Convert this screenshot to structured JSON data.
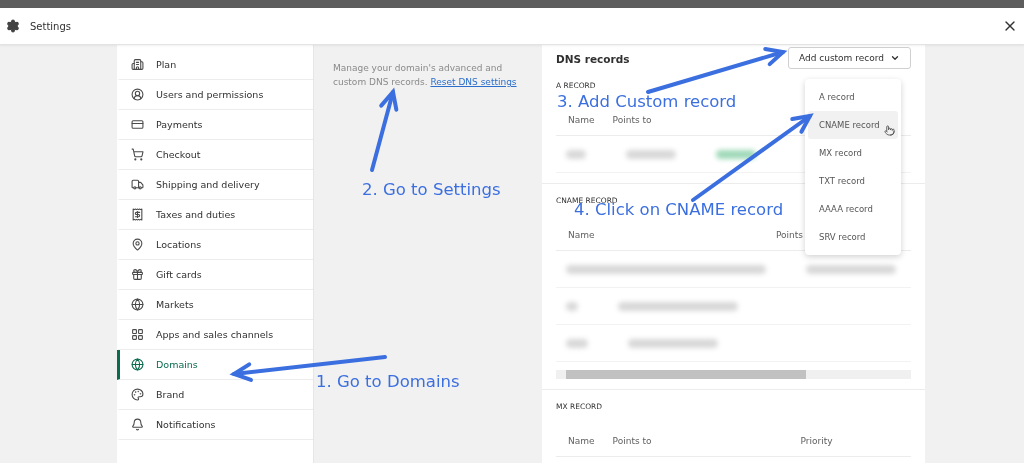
{
  "window": {
    "title": "Settings"
  },
  "sidebar": {
    "items": [
      {
        "label": "Plan",
        "selected": false
      },
      {
        "label": "Users and permissions",
        "selected": false
      },
      {
        "label": "Payments",
        "selected": false
      },
      {
        "label": "Checkout",
        "selected": false
      },
      {
        "label": "Shipping and delivery",
        "selected": false
      },
      {
        "label": "Taxes and duties",
        "selected": false
      },
      {
        "label": "Locations",
        "selected": false
      },
      {
        "label": "Gift cards",
        "selected": false
      },
      {
        "label": "Markets",
        "selected": false
      },
      {
        "label": "Apps and sales channels",
        "selected": false
      },
      {
        "label": "Domains",
        "selected": true
      },
      {
        "label": "Brand",
        "selected": false
      },
      {
        "label": "Notifications",
        "selected": false
      }
    ]
  },
  "advanced": {
    "description": "Manage your domain's advanced and custom DNS records.",
    "link": "Reset DNS settings"
  },
  "dns": {
    "title": "DNS records",
    "add_button": "Add custom record",
    "menu": [
      {
        "label": "A record",
        "selected": false
      },
      {
        "label": "CNAME record",
        "selected": true
      },
      {
        "label": "MX record",
        "selected": false
      },
      {
        "label": "TXT record",
        "selected": false
      },
      {
        "label": "AAAA record",
        "selected": false
      },
      {
        "label": "SRV record",
        "selected": false
      }
    ],
    "sections": [
      {
        "title": "A RECORD",
        "columns": [
          "Name",
          "Points to"
        ]
      },
      {
        "title": "CNAME RECORD",
        "columns": [
          "Name",
          "Points"
        ]
      },
      {
        "title": "MX RECORD",
        "columns": [
          "Name",
          "Points to",
          "Priority"
        ]
      }
    ]
  },
  "annotations": [
    {
      "text": "3. Add Custom record"
    },
    {
      "text": "2. Go to Settings"
    },
    {
      "text": "4. Click on CNAME record"
    },
    {
      "text": "1. Go to Domains"
    }
  ]
}
